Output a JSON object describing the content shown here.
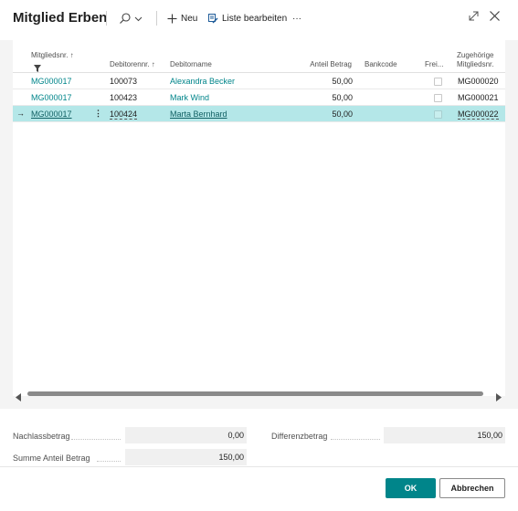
{
  "header": {
    "title": "Mitglied Erben",
    "new_label": "Neu",
    "edit_list_label": "Liste bearbeiten",
    "more_label": "···"
  },
  "grid": {
    "columns": {
      "member_no": "Mitgliedsnr. ↑",
      "debtor_no": "Debitorennr. ↑",
      "debtor_name": "Debitorname",
      "share_amount": "Anteil Betrag",
      "bank_code": "Bankcode",
      "free": "Frei...",
      "related_member_1": "Zugehörige",
      "related_member_2": "Mitgliedsnr."
    },
    "rows": [
      {
        "member_no": "MG000017",
        "debtor_no": "100073",
        "debtor_name": "Alexandra Becker",
        "share_amount": "50,00",
        "bank_code": "",
        "related_member_no": "MG000020"
      },
      {
        "member_no": "MG000017",
        "debtor_no": "100423",
        "debtor_name": "Mark Wind",
        "share_amount": "50,00",
        "bank_code": "",
        "related_member_no": "MG000021"
      },
      {
        "member_no": "MG000017",
        "debtor_no": "100424",
        "debtor_name": "Marta Bernhard",
        "share_amount": "50,00",
        "bank_code": "",
        "related_member_no": "MG000022"
      }
    ],
    "selected_row_marker": "→",
    "row_menu": "⋮"
  },
  "footer": {
    "estate_amount_label": "Nachlassbetrag",
    "estate_amount_value": "0,00",
    "difference_label": "Differenzbetrag",
    "difference_value": "150,00",
    "sum_share_label": "Summe Anteil Betrag",
    "sum_share_value": "150,00"
  },
  "buttons": {
    "ok": "OK",
    "cancel": "Abbrechen"
  },
  "colors": {
    "accent": "#00858a",
    "selected_row": "#b4e7e8"
  }
}
